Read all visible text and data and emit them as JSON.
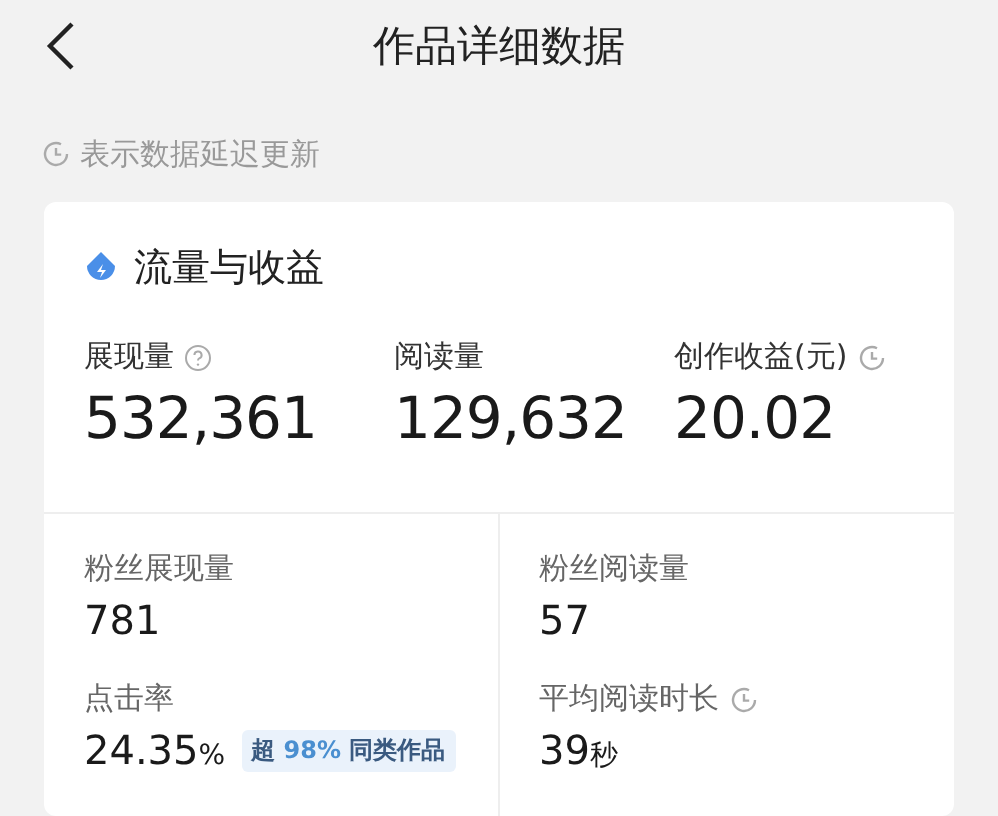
{
  "header": {
    "title": "作品详细数据"
  },
  "note": {
    "text": "表示数据延迟更新"
  },
  "card": {
    "title": "流量与收益",
    "main_metrics": [
      {
        "kind": "help",
        "label": "展现量",
        "value": "532,361"
      },
      {
        "kind": "plain",
        "label": "阅读量",
        "value": "129,632"
      },
      {
        "kind": "delayed",
        "label": "创作收益(元)",
        "value": "20.02"
      }
    ],
    "sub_metrics": [
      {
        "kind": "plain",
        "label": "粉丝展现量",
        "value": "781"
      },
      {
        "kind": "plain",
        "label": "粉丝阅读量",
        "value": "57"
      },
      {
        "kind": "plain",
        "label": "点击率",
        "value": "24.35",
        "unit": "%",
        "badge": {
          "prefix": "超",
          "highlight": "98%",
          "suffix": "同类作品"
        }
      },
      {
        "kind": "delayed",
        "label": "平均阅读时长",
        "value": "39",
        "unit": "秒"
      }
    ]
  }
}
